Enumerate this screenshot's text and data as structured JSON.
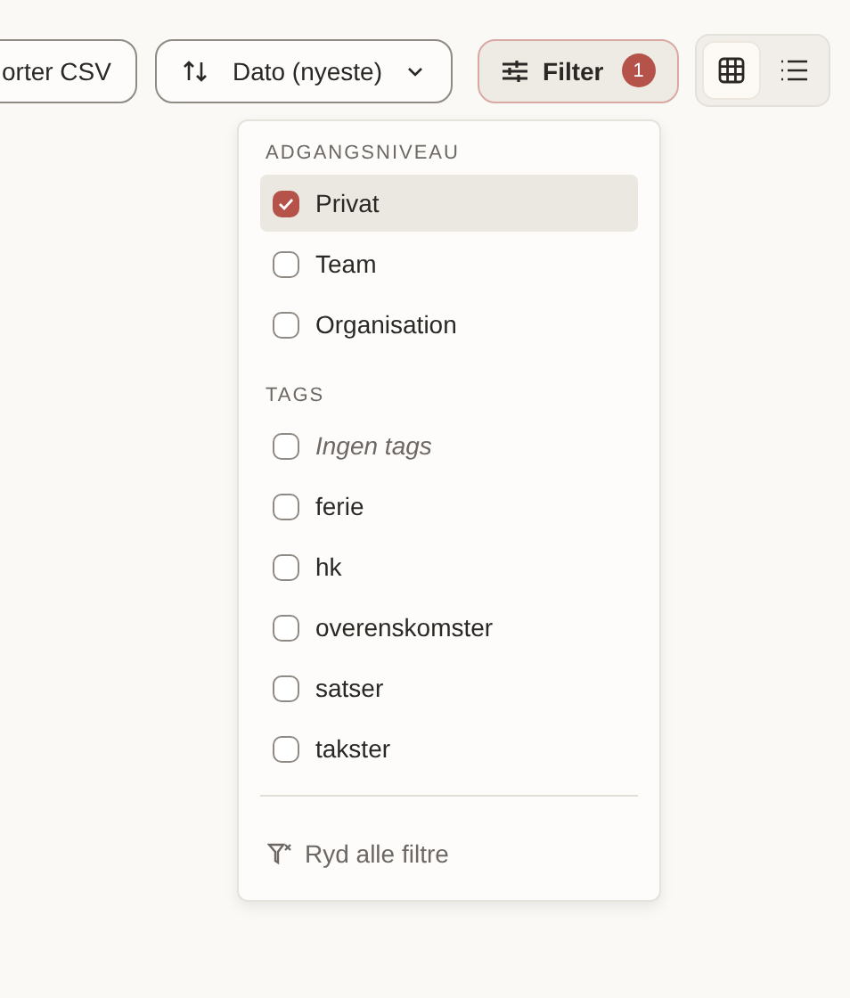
{
  "toolbar": {
    "export_button": "orter CSV",
    "sort_button": "Dato (nyeste)",
    "filter_button": {
      "label": "Filter",
      "count": "1"
    },
    "view_toggle": [
      {
        "kind": "grid",
        "selected": true
      },
      {
        "kind": "list",
        "selected": false
      }
    ]
  },
  "filter_menu": {
    "sections": [
      {
        "title": "ADGANGSNIVEAU",
        "options": [
          {
            "label": "Privat",
            "checked": true,
            "italic": false
          },
          {
            "label": "Team",
            "checked": false,
            "italic": false
          },
          {
            "label": "Organisation",
            "checked": false,
            "italic": false
          }
        ]
      },
      {
        "title": "TAGS",
        "options": [
          {
            "label": "Ingen tags",
            "checked": false,
            "italic": true
          },
          {
            "label": "ferie",
            "checked": false,
            "italic": false
          },
          {
            "label": "hk",
            "checked": false,
            "italic": false
          },
          {
            "label": "overenskomster",
            "checked": false,
            "italic": false
          },
          {
            "label": "satser",
            "checked": false,
            "italic": false
          },
          {
            "label": "takster",
            "checked": false,
            "italic": false
          }
        ]
      }
    ],
    "clear_button": "Ryd alle filtre"
  }
}
